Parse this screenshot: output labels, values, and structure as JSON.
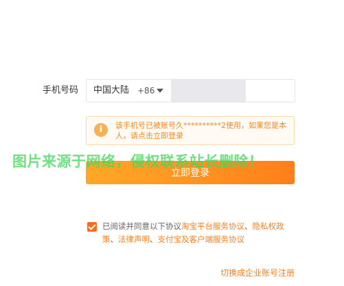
{
  "phone": {
    "label": "手机号码",
    "region": "中国大陆",
    "code": "+86",
    "value": ""
  },
  "notice": {
    "icon": "info-icon",
    "icon_glyph": "i",
    "text": "该手机号已被账号久**********2使用，如果您是本人，请点击立即登录"
  },
  "watermark": "图片来源于网络，侵权联系站长删除！",
  "login_button": "立即登录",
  "agreement": {
    "checked": true,
    "prefix": "已阅读并同意以下协议",
    "link1": "淘宝平台服务协议",
    "sep1": "、",
    "link2": "隐私权政策",
    "sep2": "、",
    "link3": "法律声明",
    "sep3": "、",
    "link4": "支付宝及客户端服务协议"
  },
  "switch_link": "切换成企业账号注册",
  "colors": {
    "accent": "#ff7e1a",
    "notice_text": "#f08a24",
    "notice_icon": "#f6b154",
    "watermark": "#48d65c"
  }
}
